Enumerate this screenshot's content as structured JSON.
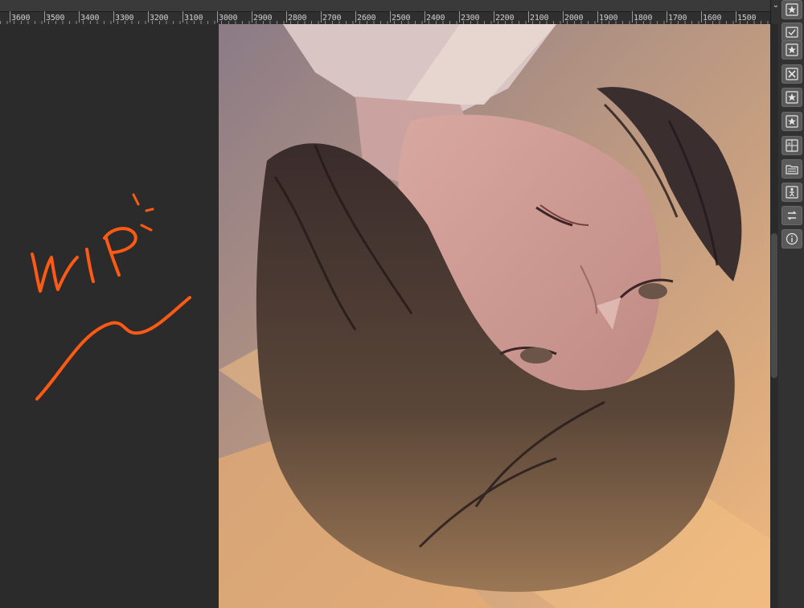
{
  "ruler": {
    "labels": [
      "3600",
      "3500",
      "3400",
      "3300",
      "3200",
      "3100",
      "3000",
      "2900",
      "2800",
      "2700",
      "2600",
      "2500",
      "2400",
      "2300",
      "2200",
      "2100",
      "2000",
      "1900",
      "1800",
      "1700",
      "1600",
      "1500"
    ]
  },
  "canvas": {
    "note_text": "WIP",
    "note_color": "#ff5a14"
  },
  "colors": {
    "workspace": "#2b2b2b",
    "ruler": "#3a3a3a",
    "panel": "#323232",
    "button": "#5a5a5a"
  },
  "toolbar": {
    "collapse_glyph": "⌄",
    "tools": [
      {
        "icon": "star-panel-icon"
      },
      {
        "icon": "checklist-panel-icon"
      },
      {
        "icon": "star-panel-icon"
      },
      {
        "icon": "close-box-icon"
      },
      {
        "icon": "star-panel-icon"
      },
      {
        "icon": "star-panel-icon"
      },
      {
        "icon": "grid-panel-icon"
      },
      {
        "icon": "folder-panel-icon"
      },
      {
        "icon": "figure-panel-icon"
      },
      {
        "icon": "swap-arrows-icon"
      },
      {
        "icon": "info-icon"
      }
    ]
  }
}
